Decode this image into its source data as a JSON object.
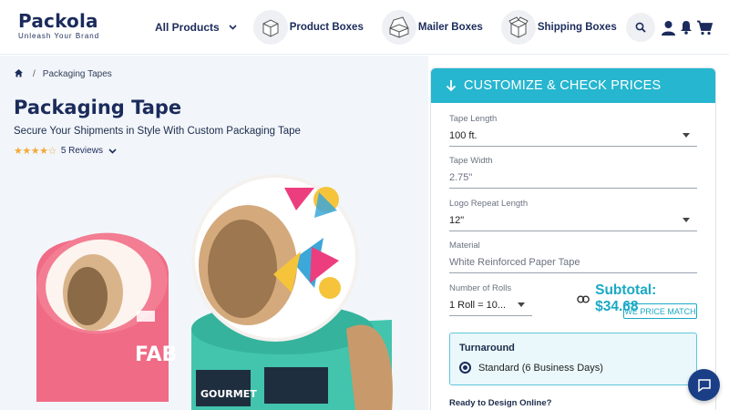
{
  "header": {
    "logo": {
      "name": "Packola",
      "tagline": "Unleash Your Brand"
    },
    "nav": {
      "all_products": "All Products",
      "items": [
        {
          "label": "Product Boxes",
          "icon": "product-box-icon"
        },
        {
          "label": "Mailer Boxes",
          "icon": "mailer-box-icon"
        },
        {
          "label": "Shipping Boxes",
          "icon": "shipping-box-icon"
        }
      ]
    },
    "icons": [
      "search-icon",
      "account-icon",
      "notification-bell-icon",
      "cart-icon"
    ]
  },
  "breadcrumb": {
    "home_icon": "home-icon",
    "current": "Packaging Tapes"
  },
  "product": {
    "title": "Packaging Tape",
    "subtitle": "Secure Your Shipments in Style With Custom Packaging Tape",
    "rating": 3.5,
    "rating_max": 5,
    "reviews_label": "5 Reviews",
    "art_text": {
      "tape_brand_1": "FAB",
      "tape_brand_2": "GOURMET"
    }
  },
  "customizer": {
    "header": "CUSTOMIZE & CHECK PRICES",
    "fields": [
      {
        "label": "Tape Length",
        "value": "100 ft.",
        "type": "select"
      },
      {
        "label": "Tape Width",
        "value": "2.75\"",
        "type": "readonly"
      },
      {
        "label": "Logo Repeat Length",
        "value": "12\"",
        "type": "select"
      },
      {
        "label": "Material",
        "value": "White Reinforced Paper Tape",
        "type": "readonly"
      },
      {
        "label": "Number of Rolls",
        "value": "1 Roll = 10...",
        "type": "select"
      }
    ],
    "subtotal": "Subtotal: $34.68",
    "price_match": "WE PRICE MATCH",
    "turnaround": {
      "title": "Turnaround",
      "option": "Standard (6 Business Days)",
      "selected": true
    },
    "ready_label": "Ready to Design Online?"
  },
  "colors": {
    "brand_navy": "#1b2b5b",
    "accent_teal": "#26b6cf",
    "star": "#f4a93a",
    "chat_button": "#1b3f86"
  }
}
